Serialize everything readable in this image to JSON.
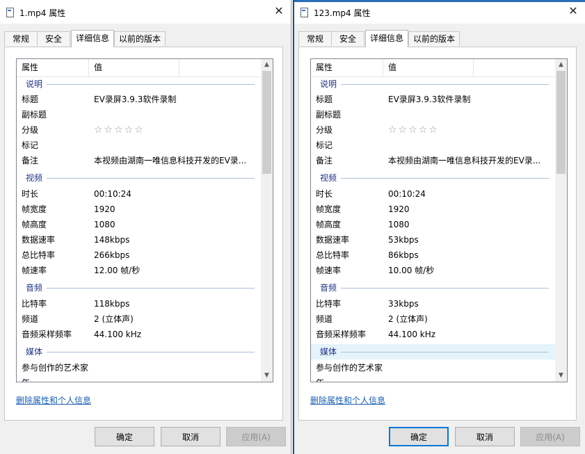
{
  "icons": {
    "file": "file-icon",
    "close": "close-icon",
    "scroll_up": "chevron-up-icon",
    "scroll_down": "chevron-down-icon"
  },
  "colors": {
    "group_label": "#1e3287",
    "link": "#1a5fb4",
    "active_border": "#0078d7",
    "selected_row": "#e5f3fb"
  },
  "windows": [
    {
      "title": "1.mp4 属性",
      "close_glyph": "✕",
      "tabs": [
        "常规",
        "安全",
        "详细信息",
        "以前的版本"
      ],
      "active_tab": 2,
      "columns": {
        "property": "属性",
        "value": "值"
      },
      "groups": {
        "description": "说明",
        "video": "视频",
        "audio": "音频",
        "media": "媒体"
      },
      "rows": {
        "title": {
          "k": "标题",
          "v": "EV录屏3.9.3软件录制"
        },
        "subtitle": {
          "k": "副标题",
          "v": ""
        },
        "rating": {
          "k": "分级",
          "v": "☆☆☆☆☆"
        },
        "tags": {
          "k": "标记",
          "v": ""
        },
        "comments": {
          "k": "备注",
          "v": "本视频由湖南一唯信息科技开发的EV录..."
        },
        "duration": {
          "k": "时长",
          "v": "00:10:24"
        },
        "frame_width": {
          "k": "帧宽度",
          "v": "1920"
        },
        "frame_height": {
          "k": "帧高度",
          "v": "1080"
        },
        "data_rate": {
          "k": "数据速率",
          "v": "148kbps"
        },
        "total_bitrate": {
          "k": "总比特率",
          "v": "266kbps"
        },
        "frame_rate": {
          "k": "帧速率",
          "v": "12.00 帧/秒"
        },
        "audio_bitrate": {
          "k": "比特率",
          "v": "118kbps"
        },
        "channels": {
          "k": "频道",
          "v": "2 (立体声)"
        },
        "sample_rate": {
          "k": "音频采样频率",
          "v": "44.100 kHz"
        },
        "contributing_artists": {
          "k": "参与创作的艺术家",
          "v": ""
        },
        "year": {
          "k": "年",
          "v": ""
        }
      },
      "remove_link": "删除属性和个人信息",
      "buttons": {
        "ok": "确定",
        "cancel": "取消",
        "apply": "应用(A)"
      }
    },
    {
      "title": "123.mp4 属性",
      "close_glyph": "✕",
      "tabs": [
        "常规",
        "安全",
        "详细信息",
        "以前的版本"
      ],
      "active_tab": 2,
      "columns": {
        "property": "属性",
        "value": "值"
      },
      "groups": {
        "description": "说明",
        "video": "视频",
        "audio": "音频",
        "media": "媒体"
      },
      "rows": {
        "title": {
          "k": "标题",
          "v": "EV录屏3.9.3软件录制"
        },
        "subtitle": {
          "k": "副标题",
          "v": ""
        },
        "rating": {
          "k": "分级",
          "v": "☆☆☆☆☆"
        },
        "tags": {
          "k": "标记",
          "v": ""
        },
        "comments": {
          "k": "备注",
          "v": "本视频由湖南一唯信息科技开发的EV录..."
        },
        "duration": {
          "k": "时长",
          "v": "00:10:24"
        },
        "frame_width": {
          "k": "帧宽度",
          "v": "1920"
        },
        "frame_height": {
          "k": "帧高度",
          "v": "1080"
        },
        "data_rate": {
          "k": "数据速率",
          "v": "53kbps"
        },
        "total_bitrate": {
          "k": "总比特率",
          "v": "86kbps"
        },
        "frame_rate": {
          "k": "帧速率",
          "v": "10.00 帧/秒"
        },
        "audio_bitrate": {
          "k": "比特率",
          "v": "33kbps"
        },
        "channels": {
          "k": "频道",
          "v": "2 (立体声)"
        },
        "sample_rate": {
          "k": "音频采样频率",
          "v": "44.100 kHz"
        },
        "contributing_artists": {
          "k": "参与创作的艺术家",
          "v": ""
        },
        "year": {
          "k": "年",
          "v": ""
        }
      },
      "remove_link": "删除属性和个人信息",
      "buttons": {
        "ok": "确定",
        "cancel": "取消",
        "apply": "应用(A)"
      }
    }
  ]
}
